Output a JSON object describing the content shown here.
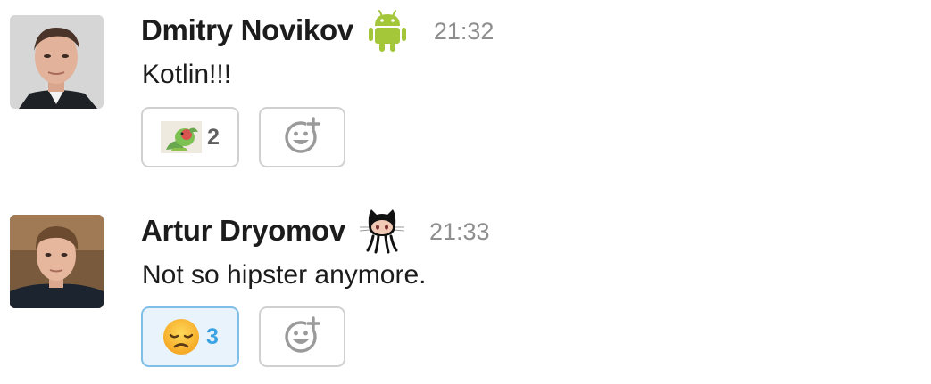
{
  "messages": [
    {
      "author": "Dmitry Novikov",
      "badge_icon": "android-icon",
      "time": "21:32",
      "text": "Kotlin!!!",
      "reactions": [
        {
          "emoji": "parrot-emoji",
          "count": "2",
          "active": false
        }
      ]
    },
    {
      "author": "Artur Dryomov",
      "badge_icon": "octocat-icon",
      "time": "21:33",
      "text": "Not so hipster anymore.",
      "reactions": [
        {
          "emoji": "disappointed-face-emoji",
          "count": "3",
          "active": true
        }
      ]
    }
  ],
  "colors": {
    "author": "#1d1c1d",
    "timestamp": "#8e8e8e",
    "reaction_border": "#d0d0d0",
    "reaction_active_bg": "#e8f3fb",
    "reaction_active_border": "#7fbee7",
    "reaction_active_count": "#3aa3e3",
    "android_green": "#a4c639"
  }
}
